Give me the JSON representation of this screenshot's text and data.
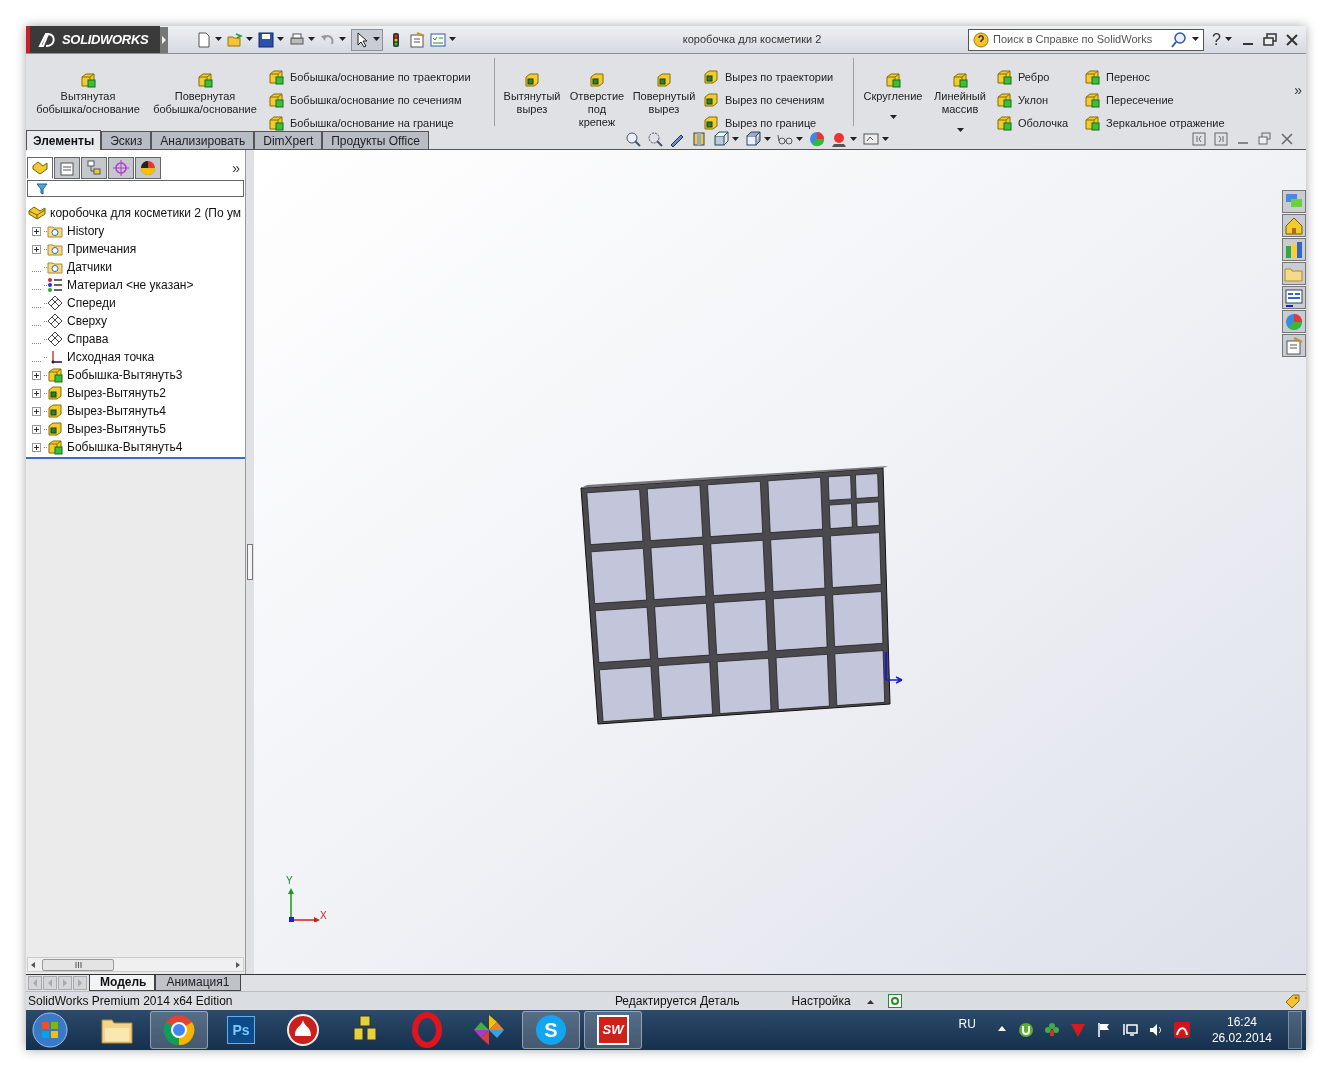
{
  "titlebar": {
    "logo_text": "SOLIDWORKS",
    "title": "коробочка для косметики 2",
    "search": {
      "placeholder": "Поиск в Справке по SolidWorks"
    },
    "help": "?"
  },
  "ribbon": {
    "groups": [
      [
        {
          "kind": "large",
          "label": "Вытянутая\nбобышка/основание",
          "has_menu": false
        },
        {
          "kind": "large",
          "label": "Повернутая\nбобышка/основание",
          "has_menu": false
        },
        {
          "kind": "stack",
          "items": [
            "Бобышка/основание по траектории",
            "Бобышка/основание по сечениям",
            "Бобышка/основание на границе"
          ]
        }
      ],
      [
        {
          "kind": "large",
          "label": "Вытянутый\nвырез",
          "has_menu": false
        },
        {
          "kind": "large",
          "label": "Отверстие\nпод\nкрепеж",
          "has_menu": false
        },
        {
          "kind": "large",
          "label": "Повернутый\nвырез",
          "has_menu": false
        },
        {
          "kind": "stack",
          "items": [
            "Вырез по траектории",
            "Вырез по сечениям",
            "Вырез по границе"
          ]
        }
      ],
      [
        {
          "kind": "large",
          "label": "Скругление",
          "has_menu": true
        },
        {
          "kind": "large",
          "label": "Линейный\nмассив",
          "has_menu": true
        },
        {
          "kind": "stack",
          "items": [
            "Ребро",
            "Уклон",
            "Оболочка"
          ]
        },
        {
          "kind": "stack",
          "items": [
            "Перенос",
            "Пересечение",
            "Зеркальное отражение"
          ]
        }
      ]
    ],
    "more": "»"
  },
  "tabs": [
    {
      "label": "Элементы",
      "selected": true
    },
    {
      "label": "Эскиз",
      "selected": false
    },
    {
      "label": "Анализировать",
      "selected": false
    },
    {
      "label": "DimXpert",
      "selected": false
    },
    {
      "label": "Продукты Office",
      "selected": false
    }
  ],
  "panel": {
    "tabs": [
      {
        "selected": true
      },
      {
        "selected": false
      },
      {
        "selected": false
      },
      {
        "selected": false
      },
      {
        "selected": false
      }
    ],
    "more": "»",
    "tree": {
      "label": "коробочка для косметики 2  (По ум",
      "kind": "part",
      "expandable": false,
      "children": [
        {
          "label": "History",
          "kind": "folder",
          "expandable": true
        },
        {
          "label": "Примечания",
          "kind": "folder",
          "expandable": true
        },
        {
          "label": "Датчики",
          "kind": "folder",
          "expandable": false
        },
        {
          "label": "Материал <не указан>",
          "kind": "material",
          "expandable": false
        },
        {
          "label": "Спереди",
          "kind": "plane",
          "expandable": false
        },
        {
          "label": "Сверху",
          "kind": "plane",
          "expandable": false
        },
        {
          "label": "Справа",
          "kind": "plane",
          "expandable": false
        },
        {
          "label": "Исходная точка",
          "kind": "origin",
          "expandable": false
        },
        {
          "label": "Бобышка-Вытянуть3",
          "kind": "feature",
          "expandable": true
        },
        {
          "label": "Вырез-Вытянуть2",
          "kind": "cut",
          "expandable": true
        },
        {
          "label": "Вырез-Вытянуть4",
          "kind": "cut",
          "expandable": true
        },
        {
          "label": "Вырез-Вытянуть5",
          "kind": "cut",
          "expandable": true
        },
        {
          "label": "Бобышка-Вытянуть4",
          "kind": "feature",
          "expandable": true
        }
      ]
    }
  },
  "viewport": {
    "triad": {
      "y_label": "Y",
      "x_label": "X"
    }
  },
  "bottom_tabs": [
    {
      "label": "Модель",
      "selected": true
    },
    {
      "label": "Анимация1",
      "selected": false
    }
  ],
  "status_bar": {
    "edition": "SolidWorks Premium 2014 x64 Edition",
    "mode": "Редактируется Деталь",
    "settings": "Настройка"
  },
  "taskbar": {
    "apps": [
      {
        "selected": false
      },
      {
        "selected": true
      },
      {
        "selected": false,
        "label": "Ps"
      },
      {
        "selected": false
      },
      {
        "selected": false
      },
      {
        "selected": false
      },
      {
        "selected": false
      },
      {
        "selected": true,
        "label": "S"
      },
      {
        "selected": true,
        "label": "SW"
      }
    ],
    "language": "RU",
    "time": "16:24",
    "date": "26.02.2014"
  }
}
